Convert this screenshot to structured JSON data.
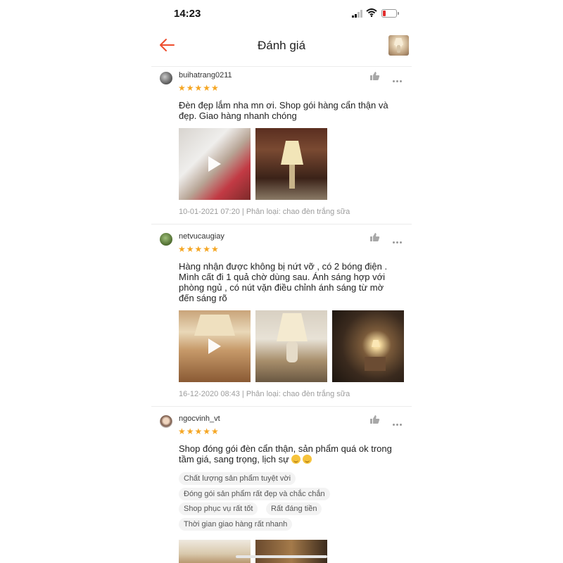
{
  "status_bar": {
    "time": "14:23"
  },
  "header": {
    "title": "Đánh giá"
  },
  "reviews": [
    {
      "username": "buihatrang0211",
      "stars": "★★★★★",
      "text": "Đèn đẹp lắm nha mn ơi. Shop gói hàng cẩn thận và đẹp. Giao hàng nhanh chóng",
      "meta": "10-01-2021 07:20 | Phân loại: chao đèn trắng sữa"
    },
    {
      "username": "netvucaugiay",
      "stars": "★★★★★",
      "text": "Hàng nhận được không bị nứt vỡ , có 2 bóng điện . Mình cất đi 1 quả chờ dùng sau. Ánh sáng hợp với phòng ngủ , có nút vặn điều chỉnh ánh sáng từ mờ đến sáng rõ",
      "meta": "16-12-2020 08:43 | Phân loại: chao đèn trắng sữa"
    },
    {
      "username": "ngocvinh_vt",
      "stars": "★★★★★",
      "text": "Shop đóng gói đèn cẩn thận, sản phẩm quá ok trong tầm giá, sang trọng, lịch sự",
      "tags": [
        "Chất lượng sản phẩm tuyệt vời",
        "Đóng gói sản phẩm rất đẹp và chắc chắn",
        "Shop phục vụ rất tốt",
        "Rất đáng tiền",
        "Thời gian giao hàng rất nhanh"
      ]
    }
  ],
  "colors": {
    "star": "#f5a623",
    "accent": "#ee4d2d",
    "meta": "#9c9c9c"
  },
  "icons": [
    "back-arrow-icon",
    "like-icon",
    "more-icon",
    "play-icon",
    "smile-emoji-icon"
  ]
}
